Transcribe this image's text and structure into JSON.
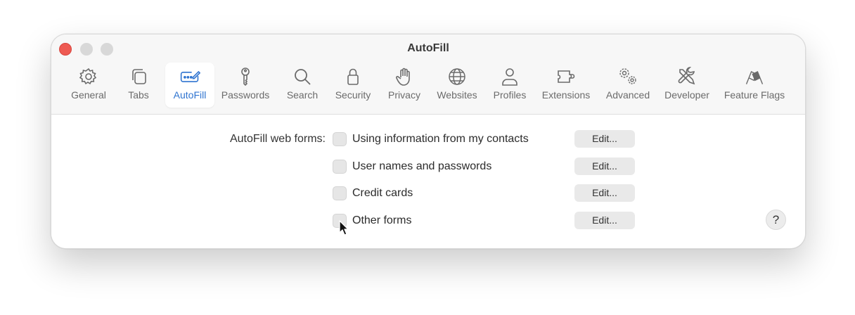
{
  "window": {
    "title": "AutoFill"
  },
  "toolbar": {
    "items": [
      {
        "label": "General",
        "icon": "gear-icon"
      },
      {
        "label": "Tabs",
        "icon": "tabs-icon"
      },
      {
        "label": "AutoFill",
        "icon": "autofill-icon",
        "active": true
      },
      {
        "label": "Passwords",
        "icon": "key-icon"
      },
      {
        "label": "Search",
        "icon": "magnifier-icon"
      },
      {
        "label": "Security",
        "icon": "lock-icon"
      },
      {
        "label": "Privacy",
        "icon": "hand-icon"
      },
      {
        "label": "Websites",
        "icon": "globe-icon"
      },
      {
        "label": "Profiles",
        "icon": "person-icon"
      },
      {
        "label": "Extensions",
        "icon": "puzzle-icon"
      },
      {
        "label": "Advanced",
        "icon": "gears-icon"
      },
      {
        "label": "Developer",
        "icon": "tools-icon"
      },
      {
        "label": "Feature Flags",
        "icon": "flags-icon"
      }
    ]
  },
  "autofill": {
    "section_label": "AutoFill web forms:",
    "options": [
      {
        "label": "Using information from my contacts",
        "checked": false,
        "button": "Edit..."
      },
      {
        "label": "User names and passwords",
        "checked": false,
        "button": "Edit..."
      },
      {
        "label": "Credit cards",
        "checked": false,
        "button": "Edit..."
      },
      {
        "label": "Other forms",
        "checked": false,
        "button": "Edit..."
      }
    ]
  },
  "help": {
    "label": "?"
  },
  "colors": {
    "accent": "#2f74d0",
    "close": "#ee5a52",
    "label": "#6b6b6b"
  }
}
